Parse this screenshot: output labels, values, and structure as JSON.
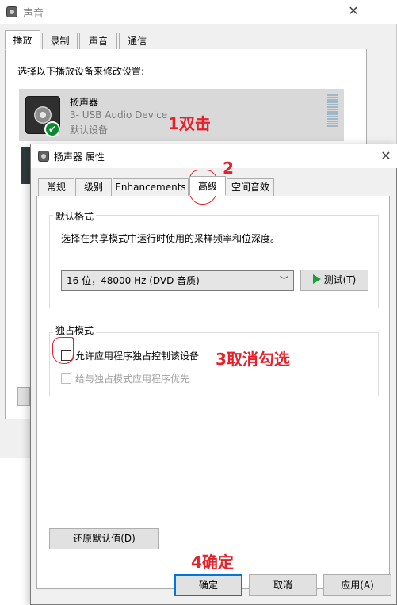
{
  "sound_window": {
    "title": "声音",
    "close_glyph": "✕",
    "tabs": [
      {
        "label": "播放",
        "active": true
      },
      {
        "label": "录制",
        "active": false
      },
      {
        "label": "声音",
        "active": false
      },
      {
        "label": "通信",
        "active": false
      }
    ],
    "instruction": "选择以下播放设备来修改设置:",
    "device": {
      "name": "扬声器",
      "description": "3- USB Audio Device",
      "status": "默认设备",
      "icon": "speaker-icon",
      "status_icon": "check-icon"
    }
  },
  "props_dialog": {
    "title": "扬声器 属性",
    "close_glyph": "✕",
    "tabs": [
      {
        "label": "常规",
        "active": false
      },
      {
        "label": "级别",
        "active": false
      },
      {
        "label": "Enhancements",
        "active": false
      },
      {
        "label": "高级",
        "active": true
      },
      {
        "label": "空间音效",
        "active": false
      }
    ],
    "default_format": {
      "group_label": "默认格式",
      "description": "选择在共享模式中运行时使用的采样频率和位深度。",
      "selected_format": "16 位，48000 Hz (DVD 音质)",
      "test_button": "测试(T)"
    },
    "exclusive_mode": {
      "group_label": "独占模式",
      "allow_exclusive": {
        "label": "允许应用程序独占控制该设备",
        "checked": false
      },
      "give_priority": {
        "label": "给与独占模式应用程序优先",
        "checked": false,
        "disabled": true
      }
    },
    "restore_defaults_button": "还原默认值(D)",
    "buttons": {
      "ok": "确定",
      "cancel": "取消",
      "apply": "应用(A)"
    }
  },
  "annotations": {
    "step1": "1双击",
    "step2": "2",
    "step3": "3取消勾选",
    "step4": "4确定",
    "color": "#e8202a"
  }
}
